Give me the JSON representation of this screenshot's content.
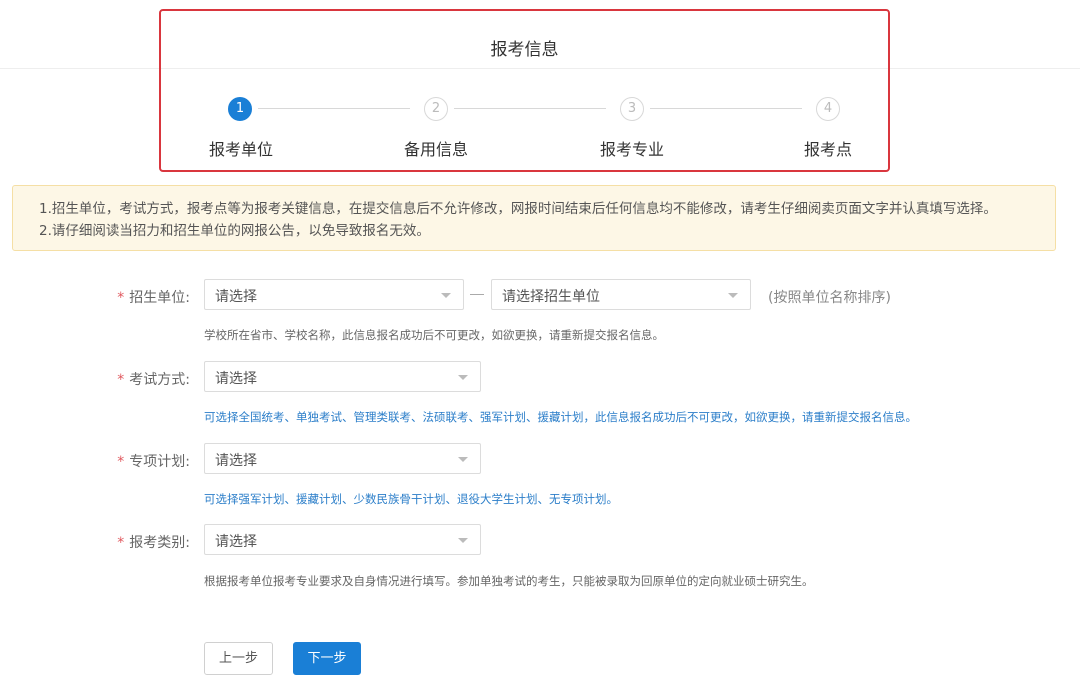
{
  "header": {
    "title": "报考信息",
    "steps": [
      {
        "num": "1",
        "label": "报考单位"
      },
      {
        "num": "2",
        "label": "备用信息"
      },
      {
        "num": "3",
        "label": "报考专业"
      },
      {
        "num": "4",
        "label": "报考点"
      }
    ],
    "active_step": 1
  },
  "notice": {
    "lines": [
      "1.招生单位，考试方式，报考点等为报考关键信息，在提交信息后不允许修改，网报时间结束后任何信息均不能修改，请考生仔细阅卖页面文字并认真填写选择。",
      "2.请仔细阅读当招力和招生单位的网报公告，以免导致报名无效。"
    ]
  },
  "form": {
    "required_mark": "*",
    "unit": {
      "label": "招生单位:",
      "select1": "请选择",
      "select2": "请选择招生单位",
      "side_note": "(按照单位名称排序)",
      "hint": "学校所在省市、学校名称，此信息报名成功后不可更改，如欲更换，请重新提交报名信息。"
    },
    "exam_method": {
      "label": "考试方式:",
      "select": "请选择",
      "hint": "可选择全国统考、单独考试、管理类联考、法硕联考、强军计划、援藏计划，此信息报名成功后不可更改，如欲更换，请重新提交报名信息。"
    },
    "special_plan": {
      "label": "专项计划:",
      "select": "请选择",
      "hint": "可选择强军计划、援藏计划、少数民族骨干计划、退役大学生计划、无专项计划。"
    },
    "category": {
      "label": "报考类别:",
      "select": "请选择",
      "hint": "根据报考单位报考专业要求及自身情况进行填写。参加单独考试的考生，只能被录取为回原单位的定向就业硕士研究生。"
    }
  },
  "buttons": {
    "prev": "上一步",
    "next": "下一步"
  },
  "colors": {
    "accent": "#1a7fd6",
    "highlight_border": "#d9363e",
    "required": "#e0585e",
    "notice_bg": "#fdf7e6"
  }
}
